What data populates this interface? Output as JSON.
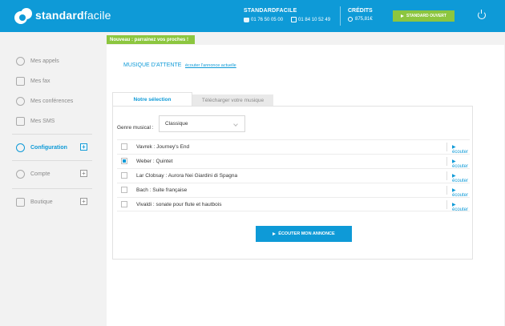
{
  "brand": {
    "name_bold": "standard",
    "name_light": "facile"
  },
  "header": {
    "standard_title": "STANDARDFACILE",
    "phone": "01 76 50 05 00",
    "fax": "01 84 10 52 49",
    "credits_title": "CRÉDITS",
    "credits_value": "875,81€",
    "open_button": "STANDARD OUVERT"
  },
  "sidebar": {
    "items": [
      {
        "label": "Mes appels"
      },
      {
        "label": "Mes fax"
      },
      {
        "label": "Mes conférences"
      },
      {
        "label": "Mes SMS"
      },
      {
        "label": "Configuration"
      },
      {
        "label": "Compte"
      },
      {
        "label": "Boutique"
      }
    ],
    "plus": "+"
  },
  "banner": "Nouveau : parrainez vos proches !",
  "main": {
    "title": "MUSIQUE D'ATTENTE",
    "listen_current_link": "écouter l'annonce actuelle",
    "tabs": [
      {
        "label": "Notre sélection"
      },
      {
        "label": "Télécharger votre musique"
      }
    ],
    "genre_label": "Genre musical :",
    "genre_value": "Classique",
    "tracks": [
      {
        "title": "Vavrek : Journey's End",
        "checked": false,
        "listen": "écouter"
      },
      {
        "title": "Weber : Quintet",
        "checked": true,
        "listen": "écouter"
      },
      {
        "title": "Lar Clobsay : Aurora Nei Giardini di Spagna",
        "checked": false,
        "listen": "écouter"
      },
      {
        "title": "Bach : Suite française",
        "checked": false,
        "listen": "écouter"
      },
      {
        "title": "Vivaldi : sonate pour flute et hautbois",
        "checked": false,
        "listen": "écouter"
      }
    ],
    "listen_button": "ÉCOUTER MON ANNONCE"
  },
  "colors": {
    "primary": "#0e9ad7",
    "accent": "#8cc63f"
  }
}
